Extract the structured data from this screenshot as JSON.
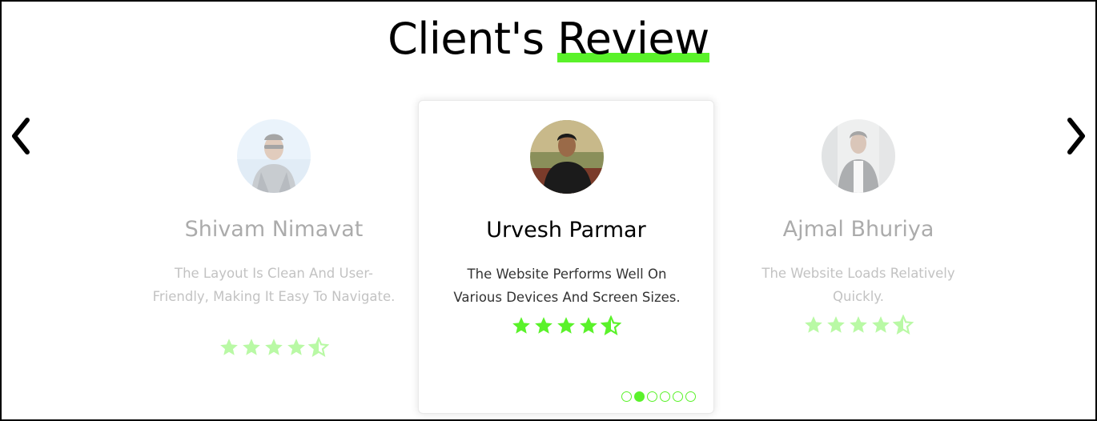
{
  "heading": {
    "part1": "Client's",
    "part2": "Review"
  },
  "colors": {
    "accent": "#5af22a",
    "text": "#000000"
  },
  "nav": {
    "prev_icon": "chevron-left-icon",
    "next_icon": "chevron-right-icon"
  },
  "cards": [
    {
      "name": "Shivam Nimavat",
      "review": "The Layout Is Clean And User-Friendly, Making It Easy To Navigate.",
      "rating": 4.5,
      "active": false
    },
    {
      "name": "Urvesh Parmar",
      "review": "The Website Performs Well On Various Devices And Screen Sizes.",
      "rating": 4.5,
      "active": true
    },
    {
      "name": "Ajmal Bhuriya",
      "review": "The Website Loads Relatively Quickly.",
      "rating": 4.5,
      "active": false
    }
  ],
  "pagination": {
    "count": 6,
    "active_index": 1
  }
}
